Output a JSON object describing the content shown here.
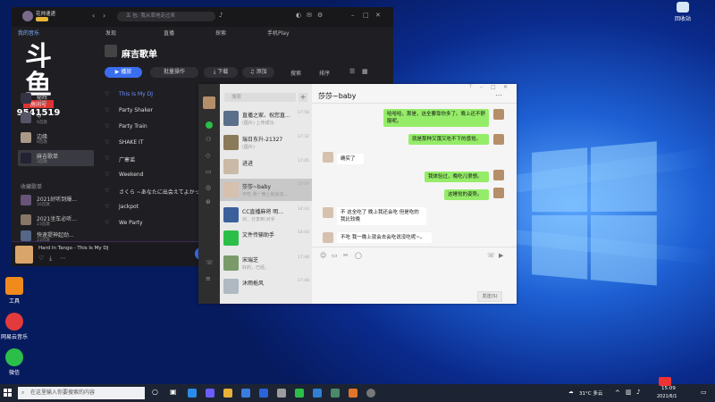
{
  "music": {
    "user_name": "花帅速递",
    "search_placeholder": "五 包: 我从草地走过来",
    "nav": {
      "discover": "发现",
      "live": "直播",
      "explore": "探索",
      "mobile_play": "手机Play"
    },
    "sidebar_links": [
      "我的音乐"
    ],
    "overlay_text": "斗鱼",
    "overlay_room_label": "房间号",
    "overlay_room_number": "9541519",
    "sidebar_playlists": [
      {
        "name": "秘辉",
        "sub": "9首歌"
      },
      {
        "name": "qr",
        "sub": "6首歌"
      },
      {
        "name": "边缘",
        "sub": "8首歌"
      },
      {
        "name": "麻吉歌单",
        "sub": "3首歌"
      }
    ],
    "collected_header": "收藏歌单",
    "collected_playlists": [
      {
        "name": "2021好听到爆...",
        "sub": "16首歌"
      },
      {
        "name": "2021坐车必听...",
        "sub": "23首歌"
      },
      {
        "name": "快速提神起劲...",
        "sub": "23首歌"
      }
    ],
    "playlist_title": "麻吉歌单",
    "buttons": {
      "play": "播放",
      "batch": "批量操作",
      "download": "下载",
      "add": "添加",
      "search": "搜索",
      "sort": "排序"
    },
    "songs": [
      "This Is My DJ",
      "Party Shaker",
      "Party Train",
      "SHAKE IT",
      "广寒谣",
      "Weekend",
      "さくら ~あなたに出会えてよかった~",
      "Jackpot",
      "We Party"
    ],
    "now_playing": "Hard In Tango - This Is My DJ"
  },
  "chat": {
    "search_placeholder": "搜索",
    "add_label": "+",
    "conversations": [
      {
        "name": "直播之家、祝您直...",
        "preview": "(图片) 上传成功",
        "time": "17:58"
      },
      {
        "name": "瑞日东升-21327",
        "preview": "(图片)",
        "time": "17:32"
      },
      {
        "name": "进进",
        "preview": "",
        "time": "17:05"
      },
      {
        "name": "莎莎~baby",
        "preview": "不吃 我一晚上就会去...",
        "time": "15:09"
      },
      {
        "name": "CC直播麻将 明...",
        "preview": "对，分享到:对手",
        "time": "14:43"
      },
      {
        "name": "文件传输助手",
        "preview": "",
        "time": "14:43"
      },
      {
        "name": "宋瑞芝",
        "preview": "好的，已经。",
        "time": "17:48"
      },
      {
        "name": "沐雨栀风",
        "preview": "",
        "time": "17:48"
      }
    ],
    "active_contact": "莎莎~baby",
    "messages": [
      {
        "side": "right",
        "text": "哈哈哈，那是，这全要靠你多了。晚上还不舒服呢。"
      },
      {
        "side": "right",
        "text": "就是那种又饿又吃不下的感觉。"
      },
      {
        "side": "left",
        "text": "确实了"
      },
      {
        "side": "right",
        "text": "我体验过，晚吃儿很想。"
      },
      {
        "side": "right",
        "text": "这睡觉的姿势。"
      },
      {
        "side": "left",
        "text": "不 这全吃了 晚上我还会吃 但是吃的我比较晚"
      },
      {
        "side": "left",
        "text": "不吃 我一晚上就会去会吃说没吃呢~。"
      }
    ],
    "send_label": "发送(S)"
  },
  "desktop_icons": [
    {
      "label": "网易云音乐",
      "color": "#e33b3b"
    },
    {
      "label": "微信",
      "color": "#2bbf4a"
    },
    {
      "label": "工具",
      "color": "#f08a1c"
    }
  ],
  "taskbar": {
    "search_placeholder": "在这里输入你要搜索的内容",
    "weather": "31°C 多云",
    "time": "15:09",
    "date": "2021/6/1",
    "recycle_label": "回收站"
  }
}
